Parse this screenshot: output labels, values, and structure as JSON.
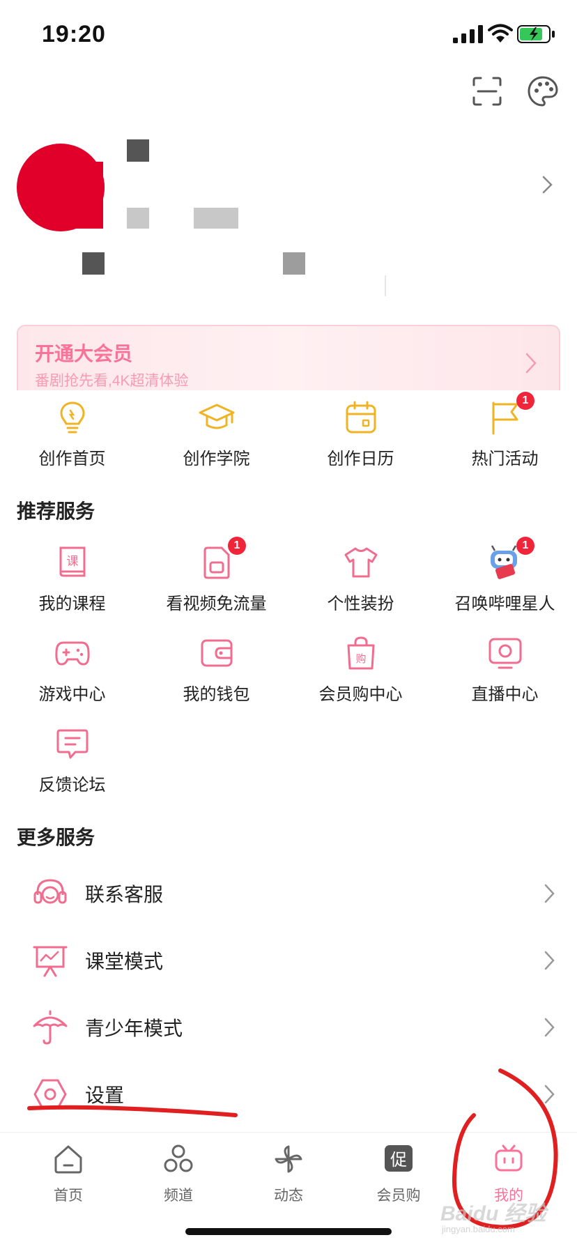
{
  "status_bar": {
    "time": "19:20"
  },
  "vip_banner": {
    "title": "开通大会员",
    "subtitle": "番剧抢先看,4K超清体验"
  },
  "creator_items": [
    {
      "label": "创作首页",
      "icon": "lightbulb-icon",
      "badge": ""
    },
    {
      "label": "创作学院",
      "icon": "graduation-cap-icon",
      "badge": ""
    },
    {
      "label": "创作日历",
      "icon": "calendar-icon",
      "badge": ""
    },
    {
      "label": "热门活动",
      "icon": "flag-icon",
      "badge": "1"
    }
  ],
  "recommended": {
    "title": "推荐服务",
    "items": [
      {
        "label": "我的课程",
        "icon": "course-book-icon",
        "badge": ""
      },
      {
        "label": "看视频免流量",
        "icon": "sim-card-icon",
        "badge": "1"
      },
      {
        "label": "个性装扮",
        "icon": "tshirt-icon",
        "badge": ""
      },
      {
        "label": "召唤哔哩星人",
        "icon": "mascot-icon",
        "badge": "1"
      },
      {
        "label": "游戏中心",
        "icon": "gamepad-icon",
        "badge": ""
      },
      {
        "label": "我的钱包",
        "icon": "wallet-icon",
        "badge": ""
      },
      {
        "label": "会员购中心",
        "icon": "shopping-bag-icon",
        "badge": ""
      },
      {
        "label": "直播中心",
        "icon": "tv-icon",
        "badge": ""
      },
      {
        "label": "反馈论坛",
        "icon": "message-icon",
        "badge": ""
      }
    ]
  },
  "more_services": {
    "title": "更多服务",
    "items": [
      {
        "label": "联系客服",
        "icon": "headset-icon"
      },
      {
        "label": "课堂模式",
        "icon": "presentation-icon"
      },
      {
        "label": "青少年模式",
        "icon": "umbrella-icon"
      },
      {
        "label": "设置",
        "icon": "settings-icon"
      }
    ]
  },
  "tabs": [
    {
      "label": "首页",
      "icon": "home-icon",
      "active": false
    },
    {
      "label": "频道",
      "icon": "channel-icon",
      "active": false
    },
    {
      "label": "动态",
      "icon": "pinwheel-icon",
      "active": false
    },
    {
      "label": "会员购",
      "icon": "promo-icon",
      "active": false,
      "glyph": "促"
    },
    {
      "label": "我的",
      "icon": "bilibili-tv-icon",
      "active": true
    }
  ],
  "colors": {
    "accent": "#fb7299",
    "gold": "#f0b323",
    "badge": "#f0253a",
    "annotation": "#e02020"
  },
  "watermark": {
    "main": "Baidu 经验",
    "sub": "jingyan.baidu.com"
  }
}
